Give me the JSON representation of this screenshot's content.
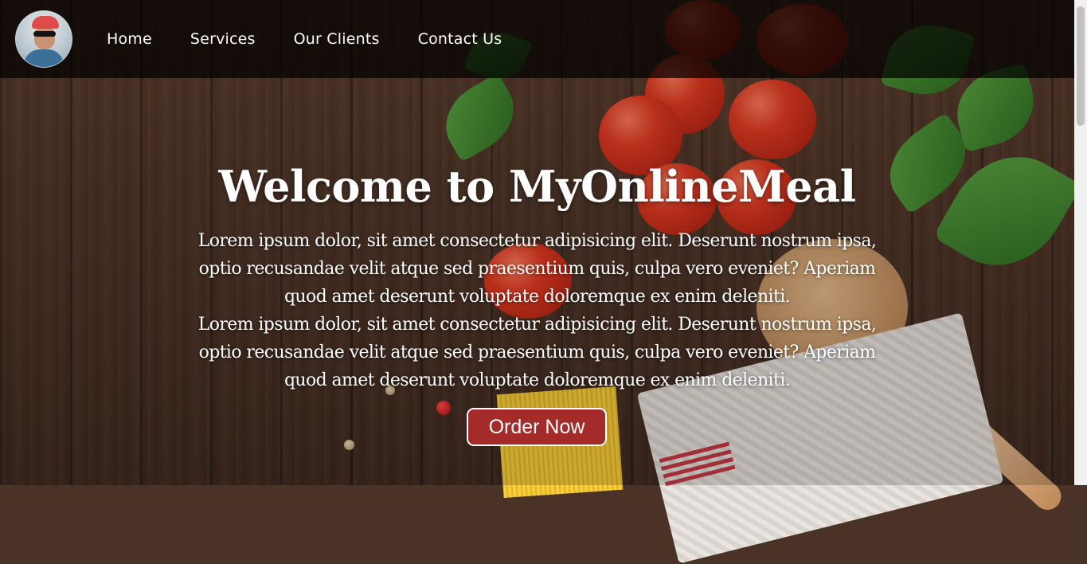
{
  "navbar": {
    "links": [
      "Home",
      "Services",
      "Our Clients",
      "Contact Us"
    ]
  },
  "hero": {
    "title": "Welcome to MyOnlineMeal",
    "paragraphs": [
      "Lorem ipsum dolor, sit amet consectetur adipisicing elit. Deserunt nostrum ipsa, optio recusandae velit atque sed praesentium quis, culpa vero eveniet? Aperiam quod amet deserunt voluptate doloremque ex enim deleniti.",
      "Lorem ipsum dolor, sit amet consectetur adipisicing elit. Deserunt nostrum ipsa, optio recusandae velit atque sed praesentium quis, culpa vero eveniet? Aperiam quod amet deserunt voluptate doloremque ex enim deleniti."
    ],
    "button_label": "Order Now"
  },
  "colors": {
    "button": "#a52a2a",
    "navbar": "rgba(0,0,0,0.72)"
  }
}
